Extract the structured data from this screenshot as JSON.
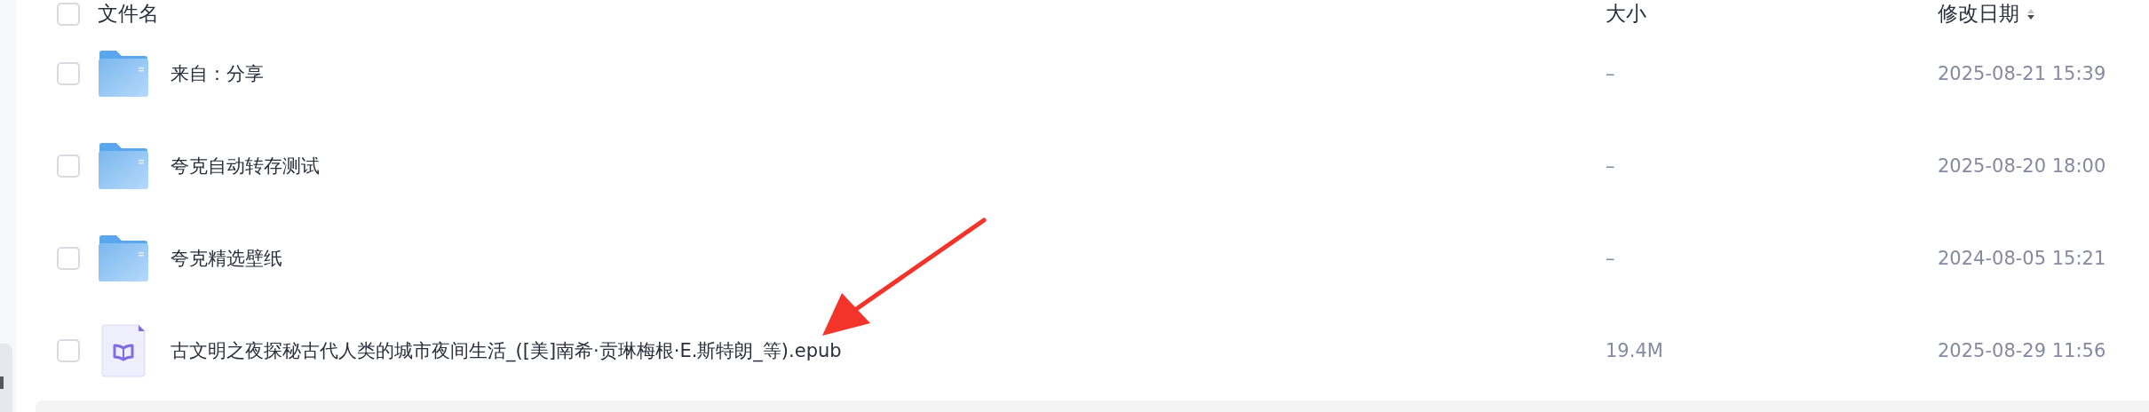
{
  "header": {
    "checked": false,
    "columns": [
      {
        "label": "文件名"
      },
      {
        "label": "大小"
      },
      {
        "label": "修改日期",
        "sorted_descending": true
      }
    ]
  },
  "rows": [
    {
      "kind": "folder",
      "checked": false,
      "name": "来自：分享",
      "size": "–",
      "modified": "2025-08-21 15:39"
    },
    {
      "kind": "folder",
      "checked": false,
      "name": "夸克自动转存测试",
      "size": "–",
      "modified": "2025-08-20 18:00"
    },
    {
      "kind": "folder",
      "checked": false,
      "name": "夸克精选壁纸",
      "size": "–",
      "modified": "2024-08-05 15:21"
    },
    {
      "kind": "ebook",
      "checked": false,
      "name": "古文明之夜探秘古代人类的城市夜间生活_([美]南希·贡琳梅根·E.斯特朗_等).epub",
      "size": "19.4M",
      "modified": "2025-08-29 11:56"
    }
  ]
}
